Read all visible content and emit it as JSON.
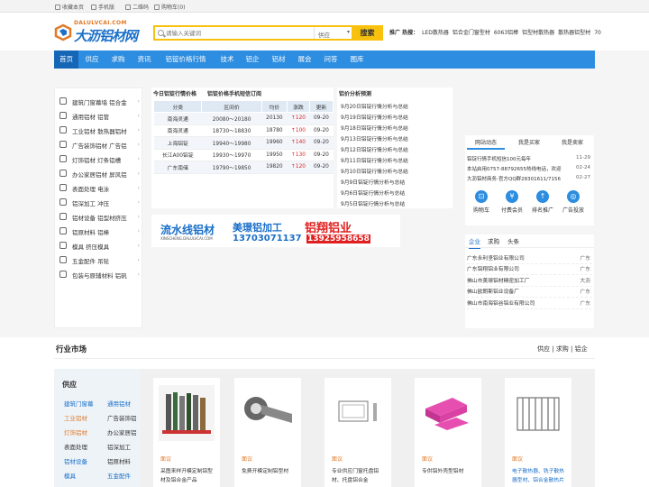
{
  "topbar": {
    "items": [
      "收藏本页",
      "手机版",
      "二维码",
      "购物车(0)"
    ]
  },
  "logo": {
    "domain": "DALULVCAI.COM",
    "name": "大沥铝材网"
  },
  "search": {
    "placeholder": "请输入关键词",
    "category": "供应",
    "button": "搜索"
  },
  "hot": {
    "label": "推广 热搜：",
    "items": [
      "LED散热器",
      "铝合金门窗型材",
      "6063铝棒",
      "铝型材散热器",
      "散热器铝型材",
      "70"
    ]
  },
  "nav": [
    "首页",
    "供应",
    "求购",
    "资讯",
    "铝锭价格行情",
    "技术",
    "铝企",
    "铝材",
    "展会",
    "问答",
    "图库"
  ],
  "categories": [
    "建筑门窗幕墙 铝合金",
    "通用铝材 铝管",
    "工业铝材 散热器铝材",
    "广告装饰铝材 广告铝",
    "灯饰铝材 灯条铝槽",
    "办公家居铝材 屏风铝",
    "表面处理 电泳",
    "铝深加工 冲压",
    "铝材设备 铝型材挤压",
    "铝原材料 铝棒",
    "模具 挤压模具",
    "五金配件 吊轮",
    "包装与原辅材料 铝矾"
  ],
  "price": {
    "title": "今日铝锭行情价格",
    "title2": "铝锭价格手机短信订阅",
    "headers": [
      "分类",
      "区间价",
      "均价",
      "涨跌",
      "更新"
    ],
    "rows": [
      [
        "南海灵通",
        "20080～20180",
        "20130",
        "↑120",
        "09-20"
      ],
      [
        "南海灵通",
        "18730～18830",
        "18780",
        "↑100",
        "09-20"
      ],
      [
        "上海铝锭",
        "19940～19980",
        "19960",
        "↑140",
        "09-20"
      ],
      [
        "长江A00铝锭",
        "19930～19970",
        "19950",
        "↑130",
        "09-20"
      ],
      [
        "广东南储",
        "19790～19850",
        "19820",
        "↑120",
        "09-20"
      ]
    ]
  },
  "analysis": {
    "title": "铝价分析预测",
    "items": [
      "9月20日铝锭行情分析与总结",
      "9月19日铝锭行情分析与总结",
      "9月18日铝锭行情分析与总结",
      "9月13日铝锭行情分析与总结",
      "9月12日铝锭行情分析与总结",
      "9月11日铝锭行情分析与总结",
      "9月10日铝锭行情分析与总结",
      "9月9日铝锭行情分析与总结",
      "9月6日铝锭行情分析与总结",
      "9月5日铝锭行情分析与总结"
    ]
  },
  "banner": {
    "a": "流水线铝材",
    "a_sub": "XINSCHENG.DALULVCAI.COM",
    "b": "美璟铝加工",
    "b_phone": "13703071137",
    "c": "铝翔铝业",
    "c_phone": "13925958658"
  },
  "rpanel": {
    "tabs": [
      "网站动态",
      "我是买家",
      "我是卖家"
    ],
    "news": [
      {
        "text": "铝锭行情手机短信100元每年",
        "date": "11-29"
      },
      {
        "text": "本站启用0757-88792655热线电话，欢迎",
        "date": "02-24"
      },
      {
        "text": "大沥铝材商务-官方QQ群28301611/7156",
        "date": "02-27"
      }
    ],
    "quick": [
      "购物车",
      "付费会员",
      "排名推广",
      "广告投放"
    ]
  },
  "companies": {
    "tabs": [
      "企业",
      "求购",
      "头条"
    ],
    "list": [
      {
        "name": "广东永利坚铝业有限公司",
        "region": "广东"
      },
      {
        "name": "广东铝翔铝业有限公司",
        "region": "广东"
      },
      {
        "name": "佛山市美璟铝材精密加工厂",
        "region": "大沥"
      },
      {
        "name": "佛山欧朗斯铝业设备厂",
        "region": "广东"
      },
      {
        "name": "佛山市南海铝谷铝业有限公司",
        "region": "广东"
      }
    ]
  },
  "market": {
    "title": "行业市场",
    "links": "供应 | 求购 | 铝企",
    "supply_title": "供应",
    "supply_links": [
      [
        "建筑门窗幕",
        "通用铝材"
      ],
      [
        "工业铝材",
        "广告装饰铝"
      ],
      [
        "灯饰铝材",
        "办公家居铝"
      ],
      [
        "表面处理",
        "铝深加工"
      ],
      [
        "铝材设备",
        "铝原材料"
      ],
      [
        "模具",
        "五金配件"
      ]
    ],
    "products": [
      {
        "mian": "面议",
        "title": "采图来样开模定制铝型材及铝合金产品"
      },
      {
        "mian": "面议",
        "title": "免费开模定制铝型材"
      },
      {
        "mian": "面议",
        "title": "专业供应门窗托盘铝材、托盘铝合金"
      },
      {
        "mian": "面议",
        "title": "专供铝外壳型铝材"
      },
      {
        "mian": "面议",
        "title": "电子散热器、铣子散热器型材、铝合金散热片"
      }
    ]
  }
}
